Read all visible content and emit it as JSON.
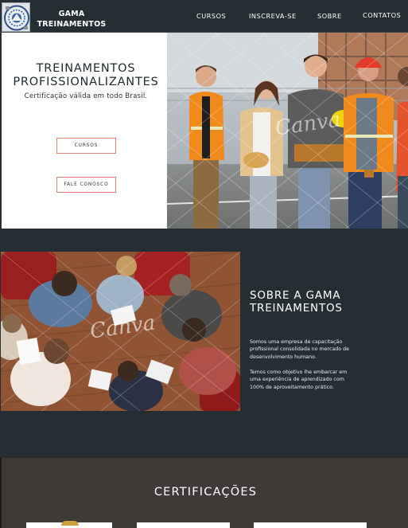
{
  "nav": {
    "brand": "GAMA\nTREINAMENTOS",
    "links": [
      "CURSOS",
      "INSCREVA-SE",
      "SOBRE",
      "CONTATOS"
    ]
  },
  "hero": {
    "title": "TREINAMENTOS PROFISSIONALIZANTES",
    "subtitle": "Certificação válida em todo Brasil.",
    "btn_cursos": "CURSOS",
    "btn_fale": "FALE CONOSCO",
    "watermark": "Canva"
  },
  "about": {
    "title": "SOBRE A GAMA TREINAMENTOS",
    "p1": "Somos uma empresa de capacitação profissional consolidada no mercado de desenvolvimento humano.",
    "p2": "Temos como objetivo lhe embarcar em uma experiência de aprendizado com 100% de aproveitamento prático.",
    "watermark": "Canva"
  },
  "cert": {
    "title": "CERTIFICAÇÕES"
  },
  "colors": {
    "dark": "#252f33",
    "accent": "#e57c73",
    "cert_bg": "#3e3a37"
  }
}
